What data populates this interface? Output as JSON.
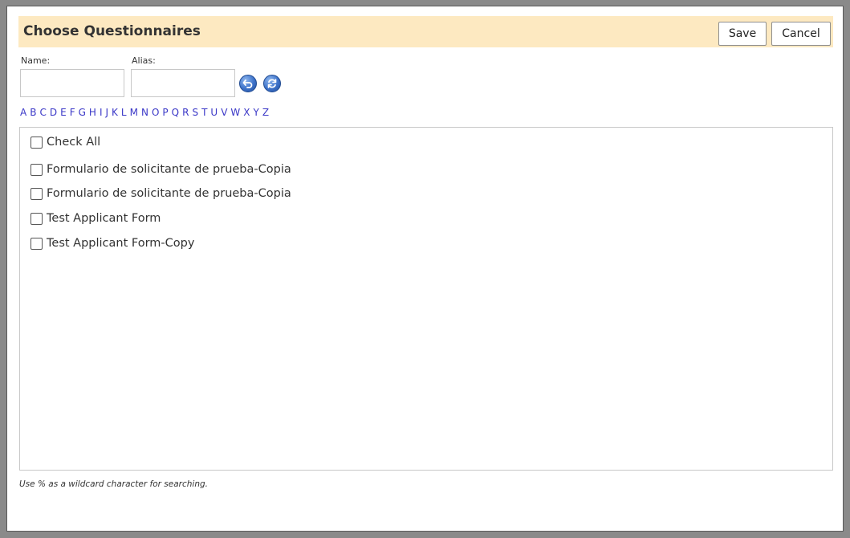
{
  "dialog": {
    "title": "Choose Questionnaires",
    "save_label": "Save",
    "cancel_label": "Cancel"
  },
  "search": {
    "name_label": "Name:",
    "name_value": "",
    "alias_label": "Alias:",
    "alias_value": ""
  },
  "icons": {
    "reset": "undo-arrow-icon",
    "search": "refresh-search-icon"
  },
  "alphabet": [
    "A",
    "B",
    "C",
    "D",
    "E",
    "F",
    "G",
    "H",
    "I",
    "J",
    "K",
    "L",
    "M",
    "N",
    "O",
    "P",
    "Q",
    "R",
    "S",
    "T",
    "U",
    "V",
    "W",
    "X",
    "Y",
    "Z"
  ],
  "list": {
    "check_all_label": "Check All",
    "items": [
      "Formulario de solicitante de prueba-Copia",
      "Formulario de solicitante de prueba-Copia",
      "Test Applicant Form",
      "Test Applicant Form-Copy"
    ]
  },
  "footer_note": "Use % as a wildcard character for searching.",
  "colors": {
    "header_bg": "#fde9c1",
    "link": "#3a37c7",
    "icon_blue": "#3d72c9"
  }
}
